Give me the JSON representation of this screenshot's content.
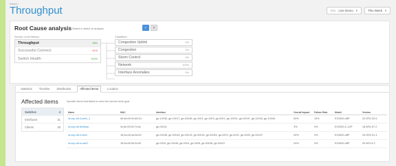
{
  "page": {
    "breadcrumb": "Wired /",
    "title": "Throughput",
    "filters": {
      "site_prefix": "Site:",
      "site_value": "Live Demo",
      "time_value": "This Week"
    }
  },
  "rca": {
    "title": "Root Cause analysis",
    "hint": "Select a metric to analyze",
    "confirm_icon": "check-icon",
    "cancel_icon": "close-icon",
    "metrics_header": "Service Level Metrics",
    "classifiers_header": "Classifiers",
    "metrics": [
      {
        "label": "Throughput",
        "value": "98%"
      },
      {
        "label": "Successful Connect",
        "value": "61%"
      },
      {
        "label": "Switch Health",
        "value": "100%"
      }
    ],
    "classifiers": [
      {
        "label": "Congestion Uplink",
        "value": "0%"
      },
      {
        "label": "Congestion",
        "value": "0%"
      },
      {
        "label": "Storm Control",
        "value": "0%"
      },
      {
        "label": "Network",
        "value": "100%"
      },
      {
        "label": "Interface Anomalies",
        "value": "0%"
      }
    ]
  },
  "panel": {
    "tabs": [
      "Statistics",
      "Timeline",
      "Distribution",
      "Affected Items",
      "Location"
    ],
    "active_tab": 3,
    "title": "Affected items",
    "hint": "Specific items that failed to meet the service level goal",
    "side": [
      {
        "label": "Switches",
        "count": "4"
      },
      {
        "label": "Interfaces",
        "count": "31"
      },
      {
        "label": "Clients",
        "count": "29"
      }
    ],
    "columns": [
      "Name",
      "MAC",
      "Interface",
      "Overall Impact",
      "Failure Rate",
      "Model",
      "Version"
    ],
    "rows": [
      [
        "ld-cup-idf-4-swt1_1",
        "d0:dd:49:91:b5:2d",
        "ge-1/0/30, ge-1/0/17, ge-0/0/45, ge-1/0/1, ge-1/0/3, ge-0/0/1, ge-1/0/31, ge-0/0/47, ge-1/0/44, ge-1/0/45",
        "53%",
        "19%",
        "EX2300-48P",
        "20.2R3-S2.6"
      ],
      [
        "ld-cup-idf-desktop",
        "3c:8c:93:94:74:dc",
        "ge-0/0/11",
        "3%",
        "0%",
        "EX2300-C-12P",
        "18.4R3-S7.2"
      ],
      [
        "ld-cup-idf-e-swt1",
        "18:2a:d3:4a:3d:00",
        "ge-0/0/46, ge-0/0/43, ge-0/0/13, ge-0/0/15, ge-0/0/45, ge-0/0/2, ge-0/0/1, ge-0/0/5, ge-0/0/47",
        "20%",
        "3%",
        "EX3400-48P",
        "20.2R3-S1.3"
      ],
      [
        "ld-cup-idf-w-swt2",
        "18:2a:d3:54:2c:62",
        "ge-0/0/0, ge-0/0/45, ge-0/0/4, ge-0/0/5, ge-0/0/36, ge-0/0/47",
        "24%",
        "3%",
        "EX3400-48P",
        "20.4R1.5.2"
      ]
    ]
  },
  "colors": {
    "accent": "#2f8fd0",
    "good": "#44a840",
    "bad": "#d64a3b",
    "edge": "#c6e58f"
  }
}
